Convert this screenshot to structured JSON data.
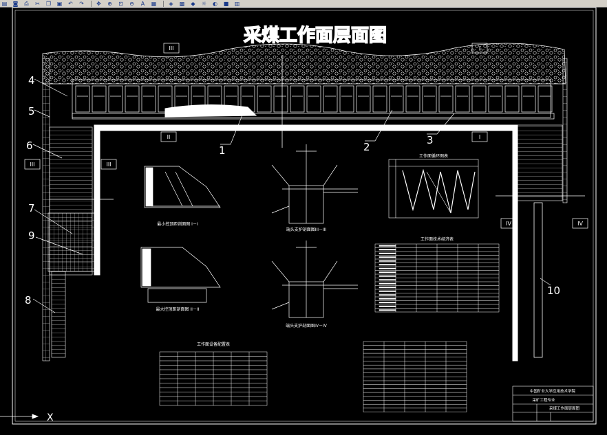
{
  "toolbar": {
    "buttons": [
      {
        "name": "open-icon",
        "glyph": "▤"
      },
      {
        "name": "save-icon",
        "glyph": "◙"
      },
      {
        "name": "print-icon",
        "glyph": "⎙"
      },
      {
        "name": "cut-icon",
        "glyph": "✂"
      },
      {
        "name": "copy-icon",
        "glyph": "❐"
      },
      {
        "name": "paste-icon",
        "glyph": "▣"
      },
      {
        "name": "undo-icon",
        "glyph": "↶"
      },
      {
        "name": "redo-icon",
        "glyph": "↷"
      },
      {
        "name": "pan-icon",
        "glyph": "✥"
      },
      {
        "name": "zoom-realtime-icon",
        "glyph": "⊕"
      },
      {
        "name": "zoom-window-icon",
        "glyph": "⊡"
      },
      {
        "name": "zoom-previous-icon",
        "glyph": "⊖"
      },
      {
        "name": "text-style-icon",
        "glyph": "A"
      },
      {
        "name": "properties-icon",
        "glyph": "▦"
      },
      {
        "name": "layer-icon",
        "glyph": "◈"
      },
      {
        "name": "calculator-icon",
        "glyph": "▩"
      },
      {
        "name": "layer-manager-icon",
        "glyph": "◆"
      },
      {
        "name": "sun-icon",
        "glyph": "☼"
      },
      {
        "name": "lock-icon",
        "glyph": "◐"
      },
      {
        "name": "color-icon",
        "glyph": "■"
      },
      {
        "name": "grid-icon",
        "glyph": "▥"
      }
    ]
  },
  "drawing": {
    "title": "采煤工作面层面图",
    "section_marks": [
      "III",
      "I",
      "II",
      "I",
      "III",
      "III",
      "IV",
      "IV"
    ],
    "callouts": [
      "1",
      "2",
      "3",
      "4",
      "5",
      "6",
      "7",
      "8",
      "9",
      "10"
    ],
    "axis_label": "X",
    "sub_captions": {
      "min_ctrl": "最小控顶距剖面图 I－I",
      "max_ctrl": "最大控顶距剖面图 II－II",
      "end_support_1": "端头支护剖面图III－III",
      "end_support_2": "端头支护剖面图IV－IV",
      "cycle_chart": "工作面循环图表",
      "tech_table": "工作面技术经济表",
      "equip_table": "工作面设备配置表"
    }
  },
  "title_block": {
    "school": "中国矿业大学应用技术学院",
    "major": "采矿工程专业",
    "drawing_name": "采煤工作面层面图"
  },
  "colors": {
    "background": "#000000",
    "line": "#ffffff",
    "toolbar": "#d4d0c8"
  }
}
